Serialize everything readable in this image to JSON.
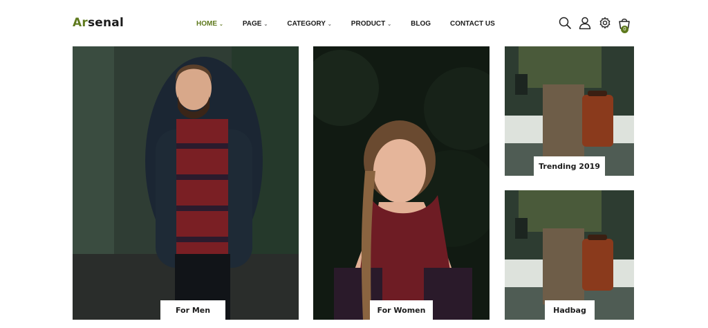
{
  "brand": {
    "accent": "Ar",
    "rest": "senal",
    "accent_color": "#5f7a1e"
  },
  "nav": {
    "items": [
      {
        "label": "HOME",
        "has_dropdown": true,
        "active": true
      },
      {
        "label": "PAGE",
        "has_dropdown": true,
        "active": false
      },
      {
        "label": "CATEGORY",
        "has_dropdown": true,
        "active": false
      },
      {
        "label": "PRODUCT",
        "has_dropdown": true,
        "active": false
      },
      {
        "label": "BLOG",
        "has_dropdown": false,
        "active": false
      },
      {
        "label": "CONTACT US",
        "has_dropdown": false,
        "active": false
      }
    ]
  },
  "header_icons": [
    "search-icon",
    "user-icon",
    "settings-icon",
    "cart-icon"
  ],
  "cart": {
    "count": "0"
  },
  "banners": [
    {
      "label": "For Men"
    },
    {
      "label": "For Women"
    },
    {
      "label": "Trending 2019"
    },
    {
      "label": "Hadbag"
    }
  ]
}
